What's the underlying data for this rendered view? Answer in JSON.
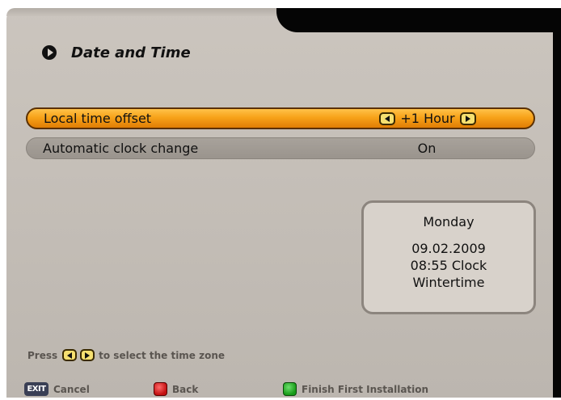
{
  "header": {
    "title": "Date and Time",
    "icon": "menu-arrow-icon"
  },
  "settings": {
    "local_time_offset": {
      "label": "Local time offset",
      "value": "+1 Hour"
    },
    "automatic_clock_change": {
      "label": "Automatic clock change",
      "value": "On"
    }
  },
  "info": {
    "day": "Monday",
    "date": "09.02.2009",
    "time": "08:55 Clock",
    "season": "Wintertime"
  },
  "hint": {
    "prefix": "Press",
    "suffix": "to select the time zone"
  },
  "footer": {
    "exit_key_label": "EXIT",
    "cancel": "Cancel",
    "back": "Back",
    "finish": "Finish First Installation"
  },
  "colors": {
    "selected_row": "#f7a219",
    "normal_row": "#a09a93",
    "panel": "#c6c0b9",
    "red_button": "#c21010",
    "green_button": "#179a17"
  }
}
